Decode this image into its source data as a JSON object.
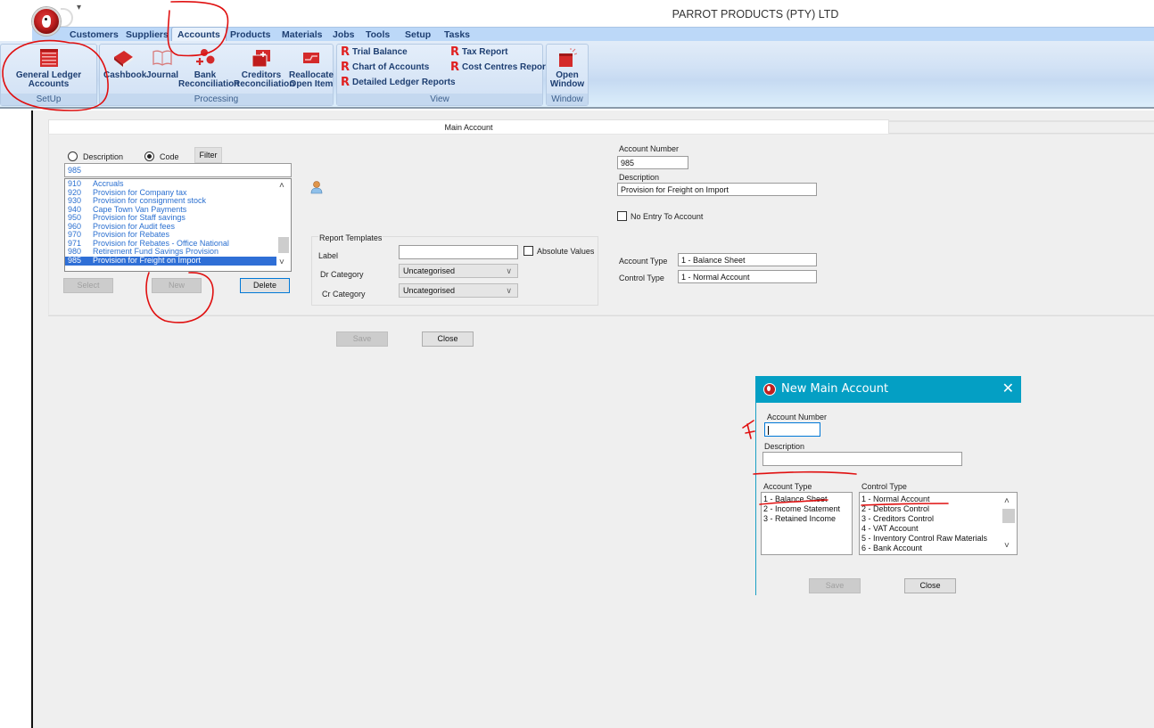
{
  "app": {
    "company_name": "PARROT PRODUCTS (PTY) LTD",
    "qat_dropdown_glyph": "▾"
  },
  "ribbon": {
    "tabs": [
      {
        "label": "Customers",
        "active": false
      },
      {
        "label": "Suppliers",
        "active": false
      },
      {
        "label": "Accounts",
        "active": true
      },
      {
        "label": "Products",
        "active": false
      },
      {
        "label": "Materials",
        "active": false
      },
      {
        "label": "Jobs",
        "active": false
      },
      {
        "label": "Tools",
        "active": false
      },
      {
        "label": "Setup",
        "active": false
      },
      {
        "label": "Tasks",
        "active": false
      }
    ],
    "groups": {
      "setup": {
        "label": "SetUp",
        "buttons": [
          {
            "label_line1": "General Ledger",
            "label_line2": "Accounts",
            "icon": "ledger-list-icon"
          }
        ]
      },
      "processing": {
        "label": "Processing",
        "buttons": [
          {
            "label_line1": "Cashbook",
            "label_line2": "",
            "icon": "book-icon"
          },
          {
            "label_line1": "Journal",
            "label_line2": "",
            "icon": "open-book-icon"
          },
          {
            "label_line1": "Bank",
            "label_line2": "Reconciliation",
            "icon": "bank-reconciliation-icon"
          },
          {
            "label_line1": "Creditors",
            "label_line2": "Reconciliation",
            "icon": "creditors-reconciliation-icon"
          },
          {
            "label_line1": "Reallocate",
            "label_line2": "Open Item",
            "icon": "reallocate-icon"
          }
        ]
      },
      "view": {
        "label": "View",
        "report_glyph": "R",
        "links": [
          {
            "label": "Trial Balance"
          },
          {
            "label": "Chart of Accounts"
          },
          {
            "label": "Detailed Ledger Reports"
          },
          {
            "label": "Tax Report"
          },
          {
            "label": "Cost Centres Report"
          }
        ]
      },
      "window": {
        "label": "Window",
        "buttons": [
          {
            "label_line1": "Open",
            "label_line2": "Window",
            "icon": "open-window-icon"
          }
        ]
      }
    }
  },
  "main_account": {
    "tab_label": "Main Account",
    "search": {
      "radio_description_label": "Description",
      "radio_code_label": "Code",
      "selected_mode": "Code",
      "filter_button": "Filter",
      "filter_value": "985"
    },
    "account_list": {
      "items": [
        {
          "code": "910",
          "description": "Accruals"
        },
        {
          "code": "920",
          "description": "Provision for Company tax"
        },
        {
          "code": "930",
          "description": "Provision for consignment stock"
        },
        {
          "code": "940",
          "description": "Cape Town Van Payments"
        },
        {
          "code": "950",
          "description": "Provision for Staff savings"
        },
        {
          "code": "960",
          "description": "Provision for Audit fees"
        },
        {
          "code": "970",
          "description": "Provision for Rebates"
        },
        {
          "code": "971",
          "description": "Provision for Rebates - Office National"
        },
        {
          "code": "980",
          "description": "Retirement Fund Savings Provision"
        },
        {
          "code": "985",
          "description": "Provision for Freight on Import"
        }
      ],
      "selected_code": "985"
    },
    "buttons": {
      "select": "Select",
      "new": "New",
      "delete": "Delete",
      "save": "Save",
      "close": "Close"
    },
    "report_templates": {
      "title": "Report Templates",
      "label_label": "Label",
      "label_value": "",
      "absolute_values_label": "Absolute Values",
      "absolute_values_checked": false,
      "dr_category_label": "Dr Category",
      "dr_category_value": "Uncategorised",
      "cr_category_label": "Cr Category",
      "cr_category_value": "Uncategorised"
    },
    "details": {
      "account_number_label": "Account Number",
      "account_number_value": "985",
      "description_label": "Description",
      "description_value": "Provision for Freight on Import",
      "no_entry_label": "No Entry To Account",
      "no_entry_checked": false,
      "account_type_label": "Account Type",
      "account_type_value": "1 - Balance Sheet",
      "control_type_label": "Control Type",
      "control_type_value": "1 - Normal Account"
    }
  },
  "dialog": {
    "title": "New Main Account",
    "close_glyph": "✕",
    "account_number_label": "Account Number",
    "account_number_value": "",
    "description_label": "Description",
    "description_value": "",
    "account_type_label": "Account Type",
    "account_types": [
      "1 - Balance Sheet",
      "2 - Income Statement",
      "3 - Retained Income"
    ],
    "control_type_label": "Control Type",
    "control_types": [
      "1 - Normal Account",
      "2 - Debtors Control",
      "3 - Creditors Control",
      "4 - VAT Account",
      "5 - Inventory Control Raw Materials",
      "6 - Bank Account"
    ],
    "save_label": "Save",
    "close_label": "Close"
  },
  "annotations": {
    "color": "#e01010",
    "cross_mark": "x"
  }
}
